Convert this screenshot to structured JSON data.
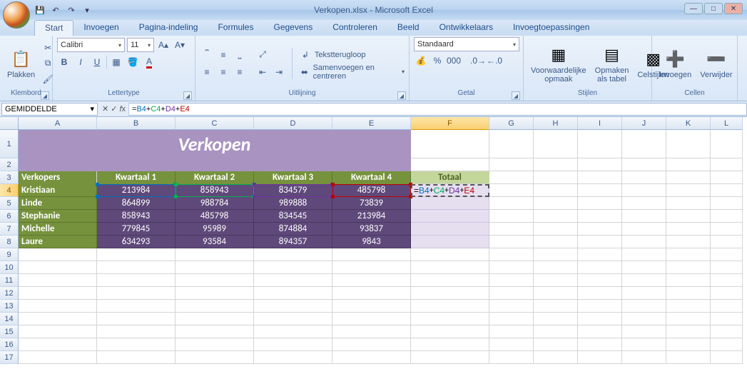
{
  "app": {
    "title": "Verkopen.xlsx - Microsoft Excel"
  },
  "qat": {
    "save": "💾",
    "undo": "↶",
    "redo": "↷"
  },
  "tabs": [
    "Start",
    "Invoegen",
    "Pagina-indeling",
    "Formules",
    "Gegevens",
    "Controleren",
    "Beeld",
    "Ontwikkelaars",
    "Invoegtoepassingen"
  ],
  "ribbon": {
    "klembord": {
      "label": "Klembord",
      "plakken": "Plakken"
    },
    "lettertype": {
      "label": "Lettertype",
      "font": "Calibri",
      "size": "11"
    },
    "uitlijning": {
      "label": "Uitlijning",
      "wrap": "Tekstterugloop",
      "merge": "Samenvoegen en centreren"
    },
    "getal": {
      "label": "Getal",
      "format": "Standaard"
    },
    "stijlen": {
      "label": "Stijlen",
      "cond": "Voorwaardelijke opmaak",
      "fmt": "Opmaken als tabel",
      "cell": "Celstijlen"
    },
    "cellen": {
      "label": "Cellen",
      "ins": "Invoegen",
      "del": "Verwijder"
    }
  },
  "formulabar": {
    "namebox": "GEMIDDELDE",
    "formula_prefix": "=",
    "r1": "B4",
    "r2": "C4",
    "r3": "D4",
    "r4": "E4",
    "plus": "+"
  },
  "cols": [
    "A",
    "B",
    "C",
    "D",
    "E",
    "F",
    "G",
    "H",
    "I",
    "J",
    "K",
    "L"
  ],
  "rows": [
    "1",
    "2",
    "3",
    "4",
    "5",
    "6",
    "7",
    "8",
    "9",
    "10",
    "11",
    "12",
    "13",
    "14",
    "15",
    "16",
    "17"
  ],
  "sheet": {
    "title": "Verkopen",
    "h0": "Verkopers",
    "h1": "Kwartaal 1",
    "h2": "Kwartaal 2",
    "h3": "Kwartaal 3",
    "h4": "Kwartaal 4",
    "h5": "Totaal",
    "names": [
      "Kristiaan",
      "Linde",
      "Stephanie",
      "Michelle",
      "Laure"
    ],
    "data": [
      [
        "213984",
        "858943",
        "834579",
        "485798"
      ],
      [
        "864899",
        "988784",
        "989888",
        "73839"
      ],
      [
        "858943",
        "485798",
        "834545",
        "213984"
      ],
      [
        "779845",
        "95989",
        "874884",
        "93837"
      ],
      [
        "634293",
        "93584",
        "894357",
        "9843"
      ]
    ],
    "editcell_parts": {
      "eq": "=",
      "b": "B4",
      "c": "C4",
      "d": "D4",
      "e": "E4",
      "p": "+"
    }
  },
  "layout": {
    "colw": {
      "A": 110,
      "B": 110,
      "C": 110,
      "D": 110,
      "E": 110,
      "F": 110,
      "G": 62,
      "H": 62,
      "I": 62,
      "J": 62,
      "K": 62,
      "L": 45
    },
    "rowh": {
      "1": 40,
      "2": 18,
      "def": 18
    }
  }
}
